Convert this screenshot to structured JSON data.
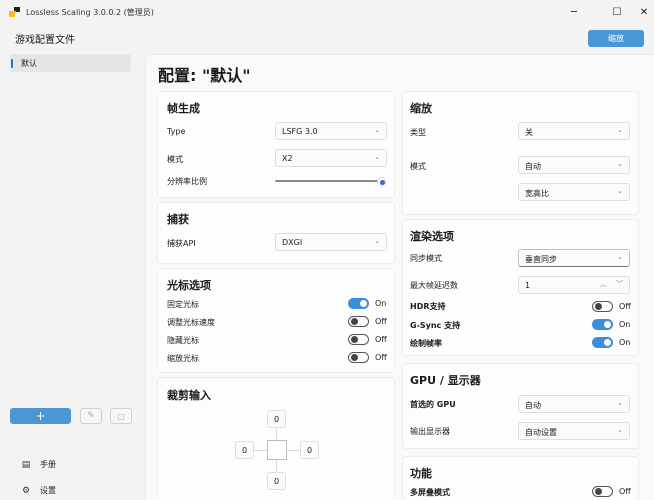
{
  "window": {
    "title": "Lossless Scaling 3.0.0.2 (管理员)",
    "controls": {
      "minimize": "─",
      "maximize": "☐",
      "close": "✕"
    }
  },
  "header": {
    "profiles_title": "游戏配置文件",
    "apply_label": "缩放"
  },
  "sidebar": {
    "items": [
      {
        "label": "默认",
        "selected": true
      }
    ],
    "add_label": "+",
    "manual_label": "手册",
    "settings_label": "设置"
  },
  "page": {
    "title": "配置: \"默认\""
  },
  "frame_gen": {
    "title": "帧生成",
    "type_label": "Type",
    "type_value": "LSFG 3.0",
    "mode_label": "模式",
    "mode_value": "X2",
    "ratio_label": "分辨率比例",
    "ratio_level": 1.0
  },
  "capture": {
    "title": "捕获",
    "api_label": "捕获API",
    "api_value": "DXGI"
  },
  "cursor": {
    "title": "光标选项",
    "items": [
      {
        "label": "固定光标",
        "state": "On"
      },
      {
        "label": "调整光标速度",
        "state": "Off"
      },
      {
        "label": "隐藏光标",
        "state": "Off"
      },
      {
        "label": "缩放光标",
        "state": "Off"
      }
    ]
  },
  "crop": {
    "title": "裁剪输入",
    "top": "0",
    "left": "0",
    "right": "0",
    "bottom": "0"
  },
  "scaling": {
    "title": "缩放",
    "type_label": "类型",
    "type_value": "关",
    "mode_label": "模式",
    "mode_value": "自动",
    "aspect_value": "宽高比"
  },
  "render": {
    "title": "渲染选项",
    "sync_label": "同步模式",
    "sync_value": "垂直同步",
    "latency_label": "最大帧延迟数",
    "latency_value": "1",
    "hdr_label": "HDR支持",
    "hdr_state": "Off",
    "gsync_label": "G-Sync 支持",
    "gsync_state": "On",
    "fps_label": "绘制帧率",
    "fps_state": "On"
  },
  "gpu": {
    "title": "GPU / 显示器",
    "gpu_label": "首选的 GPU",
    "gpu_value": "自动",
    "display_label": "输出显示器",
    "display_value": "自动设置"
  },
  "features": {
    "title": "功能",
    "multi_label": "多屏叠模式",
    "multi_state": "Off"
  },
  "icons": {
    "chevron": "⌄",
    "up": "︿",
    "down": "﹀",
    "pencil": "✎",
    "trash": "🗑",
    "book": "📖",
    "gear": "⚙"
  }
}
